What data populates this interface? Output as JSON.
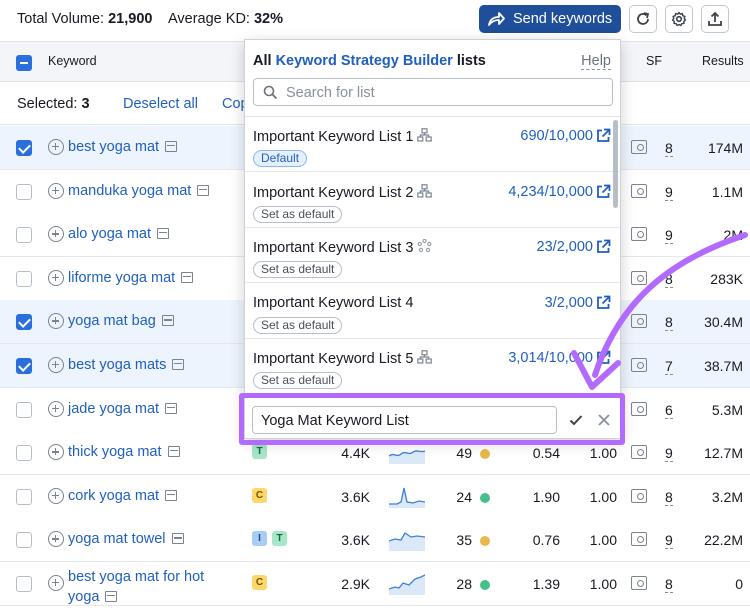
{
  "summary": {
    "total_label": "Total Volume:",
    "total_value": "21,900",
    "kd_label": "Average KD:",
    "kd_value": "32%"
  },
  "toolbar": {
    "send_label": "Send keywords"
  },
  "table": {
    "headers": {
      "keyword": "Keyword",
      "sf": "SF",
      "results": "Results"
    },
    "selected_label": "Selected:",
    "selected_count": "3",
    "deselect_label": "Deselect all",
    "copy_label": "Cop",
    "rows": [
      {
        "keyword": "best yoga mat",
        "selected": true,
        "intent": [],
        "volume": "",
        "kd": "",
        "cpc": "",
        "com": "",
        "sf": "8",
        "results": "174M"
      },
      {
        "keyword": "manduka yoga mat",
        "selected": false,
        "intent": [],
        "volume": "",
        "kd": "",
        "cpc": "",
        "com": "",
        "sf": "9",
        "results": "1.1M"
      },
      {
        "keyword": "alo yoga mat",
        "selected": false,
        "intent": [],
        "volume": "",
        "kd": "",
        "cpc": "",
        "com": "",
        "sf": "9",
        "results": "2M"
      },
      {
        "keyword": "liforme yoga mat",
        "selected": false,
        "intent": [],
        "volume": "",
        "kd": "",
        "cpc": "",
        "com": "",
        "sf": "8",
        "results": "283K"
      },
      {
        "keyword": "yoga mat bag",
        "selected": true,
        "intent": [],
        "volume": "",
        "kd": "",
        "cpc": "",
        "com": "",
        "sf": "8",
        "results": "30.4M"
      },
      {
        "keyword": "best yoga mats",
        "selected": true,
        "intent": [],
        "volume": "",
        "kd": "",
        "cpc": "",
        "com": "",
        "sf": "7",
        "results": "38.7M"
      },
      {
        "keyword": "jade yoga mat",
        "selected": false,
        "intent": [],
        "volume": "",
        "kd": "",
        "cpc": "",
        "com": "",
        "sf": "6",
        "results": "5.3M"
      },
      {
        "keyword": "thick yoga mat",
        "selected": false,
        "intent": [
          "T"
        ],
        "volume": "4.4K",
        "kd": "49",
        "kd_color": "#e8b84a",
        "cpc": "0.54",
        "com": "1.00",
        "sf": "9",
        "results": "12.7M"
      },
      {
        "keyword": "cork yoga mat",
        "selected": false,
        "intent": [
          "C"
        ],
        "volume": "3.6K",
        "kd": "24",
        "kd_color": "#45c08a",
        "cpc": "1.90",
        "com": "1.00",
        "sf": "8",
        "results": "3.2M"
      },
      {
        "keyword": "yoga mat towel",
        "selected": false,
        "intent": [
          "I",
          "T"
        ],
        "volume": "3.6K",
        "kd": "35",
        "kd_color": "#e8b84a",
        "cpc": "0.76",
        "com": "1.00",
        "sf": "9",
        "results": "22.2M"
      },
      {
        "keyword": "best yoga mat for hot yoga",
        "selected": false,
        "intent": [
          "C"
        ],
        "volume": "2.9K",
        "kd": "28",
        "kd_color": "#45c08a",
        "cpc": "1.39",
        "com": "1.00",
        "sf": "8",
        "results": "0"
      }
    ]
  },
  "popup": {
    "title_prefix": "All",
    "title_brand": "Keyword Strategy Builder",
    "title_suffix": "lists",
    "help_label": "Help",
    "search_placeholder": "Search for list",
    "lists": [
      {
        "name": "Important Keyword List 1",
        "icon": "hierarchy-icon",
        "count": "690/10,000",
        "pill": "Default",
        "is_default": true
      },
      {
        "name": "Important Keyword List 2",
        "icon": "hierarchy-icon",
        "count": "4,234/10,000",
        "pill": "Set as default",
        "is_default": false
      },
      {
        "name": "Important Keyword List 3",
        "icon": "loading-icon",
        "count": "23/2,000",
        "pill": "Set as default",
        "is_default": false
      },
      {
        "name": "Important Keyword List 4",
        "icon": "",
        "count": "3/2,000",
        "pill": "Set as default",
        "is_default": false
      },
      {
        "name": "Important Keyword List 5",
        "icon": "hierarchy-icon",
        "count": "3,014/10,000",
        "pill": "Set as default",
        "is_default": false
      }
    ],
    "new_list_value": "Yoga Mat Keyword List"
  },
  "colors": {
    "accent": "#1f4e9a",
    "link": "#1f5fbf",
    "highlight": "#b36bff",
    "kd_green": "#45c08a",
    "kd_yellow": "#e8b84a"
  }
}
